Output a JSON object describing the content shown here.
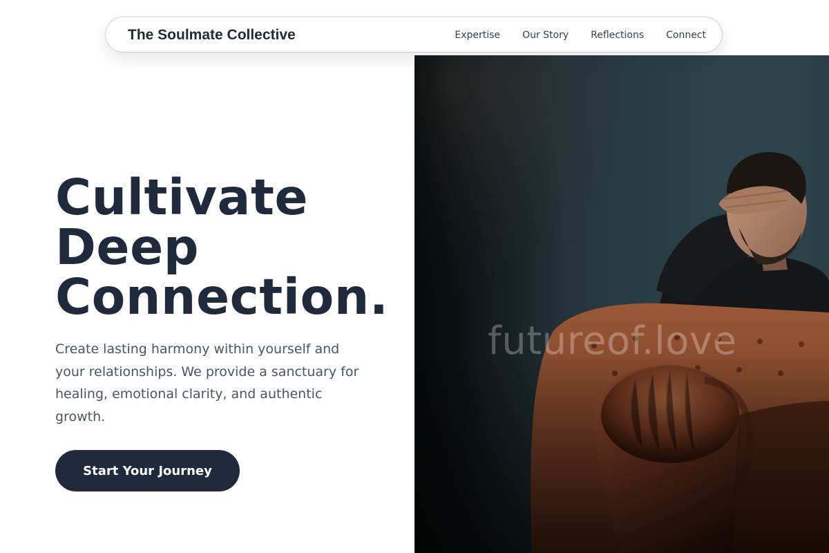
{
  "nav": {
    "brand": "The Soulmate Collective",
    "links": [
      "Expertise",
      "Our Story",
      "Reflections",
      "Connect"
    ]
  },
  "hero": {
    "headline_lines": [
      "Cultivate",
      "Deep",
      "Connection."
    ],
    "subtext": "Create lasting harmony within yourself and your relationships. We provide a sanctuary for healing, emotional clarity, and authentic growth.",
    "cta_label": "Start Your Journey",
    "image": {
      "subject": "man seated in brown leather chesterfield armchair covering his eyes with his hand",
      "watermark": "futureof.love"
    }
  },
  "colors": {
    "brand_navy": "#1f2a3c",
    "body_text": "#475569",
    "wall_teal": "#2e4850",
    "leather": "#6b3320"
  }
}
